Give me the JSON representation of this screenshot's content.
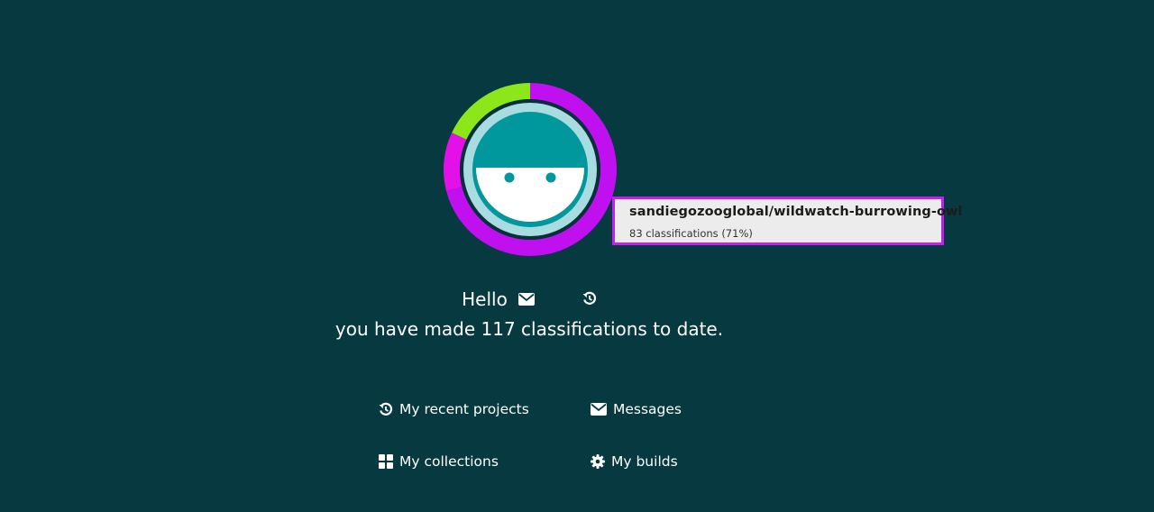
{
  "colors": {
    "background": "#063940",
    "ring_primary": "#c010f0",
    "ring_secondary": "#e310e8",
    "ring_tertiary": "#8ce61a",
    "avatar_teal": "#00979d",
    "avatar_ring": "#a8dce0",
    "tooltip_border": "#c320f0"
  },
  "profile": {
    "ring_segments": [
      {
        "project": "sandiegozooglobal/wildwatch-burrowing-owl",
        "fraction": 0.71,
        "color": "#c010f0"
      },
      {
        "fraction": 0.11,
        "color": "#e310e8"
      },
      {
        "fraction": 0.18,
        "color": "#8ce61a"
      }
    ]
  },
  "tooltip": {
    "title": "sandiegozooglobal/wildwatch-burrowing-owl",
    "subtitle": "83 classifications (71%)"
  },
  "greeting": {
    "hello": "Hello",
    "summary": "you have made 117 classifications to date."
  },
  "nav": {
    "recent_projects": "My recent projects",
    "messages": "Messages",
    "collections": "My collections",
    "builds": "My builds"
  },
  "icons": {
    "recent": "history-icon",
    "messages": "envelope-icon",
    "collections": "grid-icon",
    "builds": "gear-icon"
  }
}
